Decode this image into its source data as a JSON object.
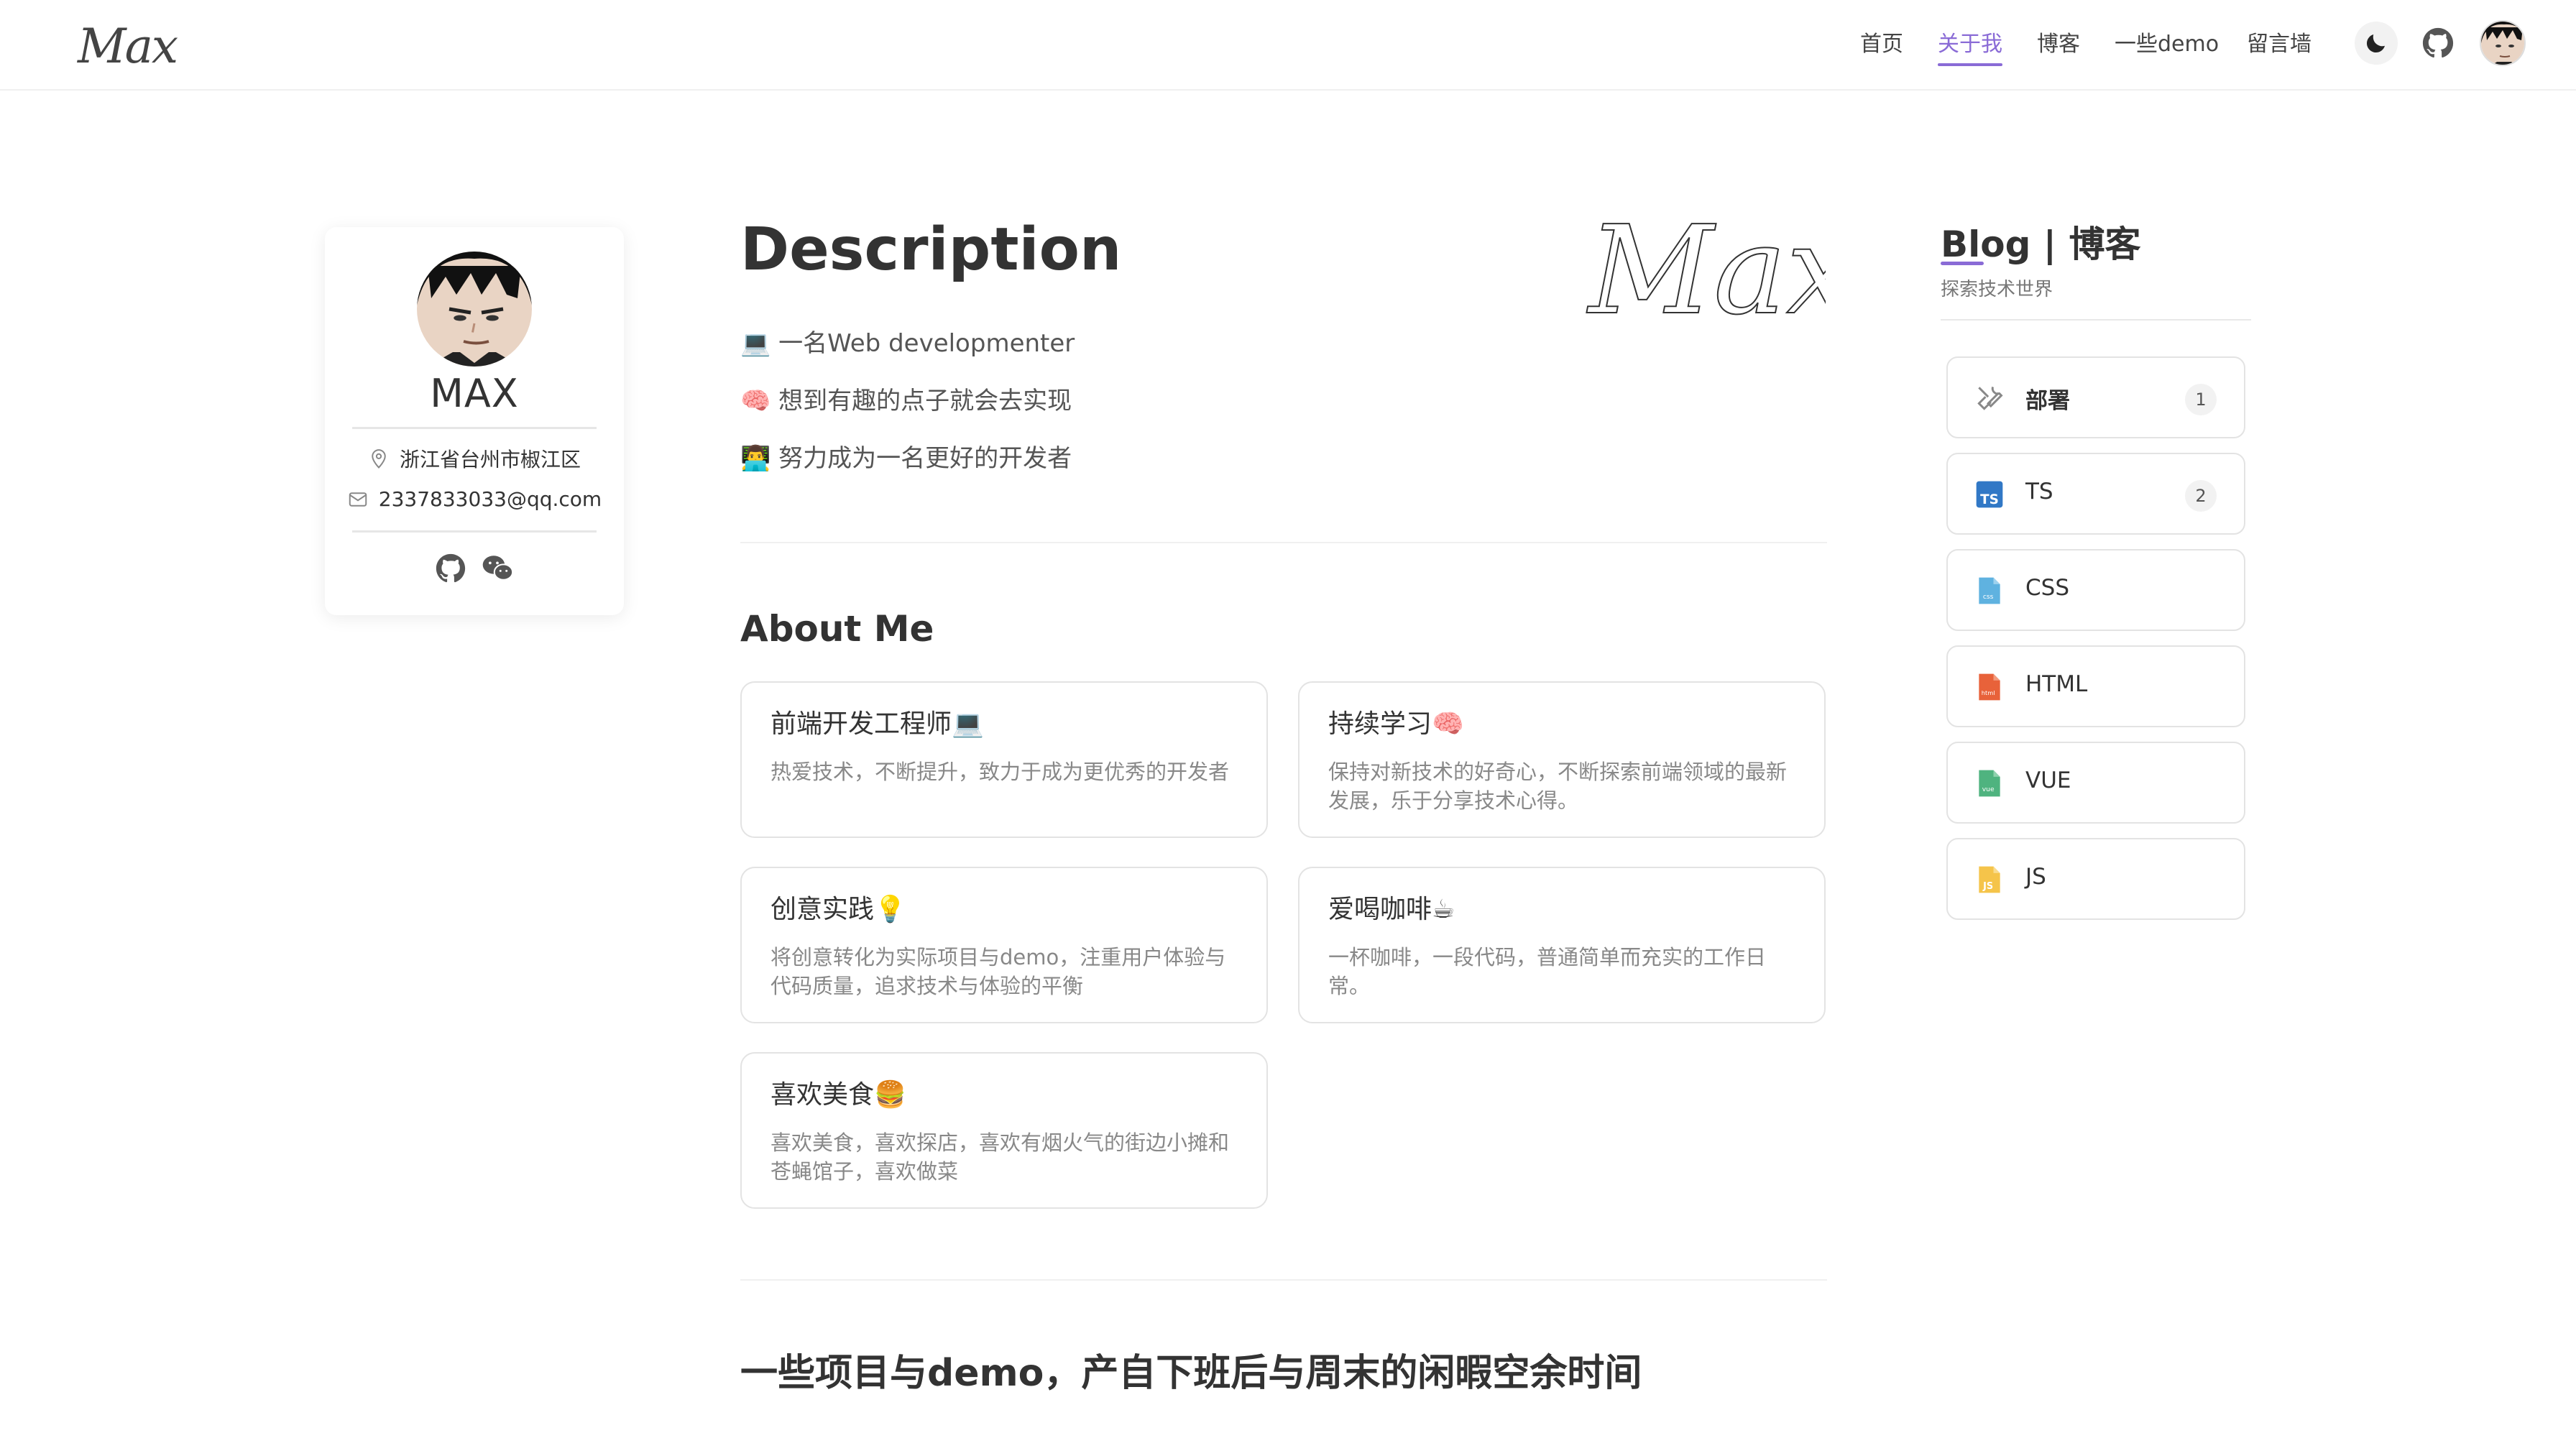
{
  "header": {
    "logo": "Max",
    "nav": [
      {
        "label": "首页",
        "active": false
      },
      {
        "label": "关于我",
        "active": true
      },
      {
        "label": "博客",
        "active": false
      },
      {
        "label": "一些demo",
        "active": false
      },
      {
        "label": "留言墙",
        "active": false
      }
    ],
    "icons": [
      "moon-icon",
      "github-icon",
      "avatar"
    ],
    "accent": "#8a6bd6"
  },
  "profile": {
    "name": "MAX",
    "location": "浙江省台州市椒江区",
    "email": "2337833033@qq.com",
    "social_icons": [
      "github-icon",
      "wechat-icon"
    ]
  },
  "description": {
    "heading": "Description",
    "signature": "Max",
    "lines": [
      "💻 一名Web developmenter",
      "🧠 想到有趣的点子就会去实现",
      "👨‍💻 努力成为一名更好的开发者"
    ]
  },
  "about": {
    "heading": "About Me",
    "cards": [
      {
        "title": "前端开发工程师💻",
        "text": "热爱技术，不断提升，致力于成为更优秀的开发者"
      },
      {
        "title": "持续学习🧠",
        "text": "保持对新技术的好奇心，不断探索前端领域的最新发展，乐于分享技术心得。"
      },
      {
        "title": "创意实践💡",
        "text": "将创意转化为实际项目与demo，注重用户体验与代码质量，追求技术与体验的平衡"
      },
      {
        "title": "爱喝咖啡☕",
        "text": "一杯咖啡，一段代码，普通简单而充实的工作日常。"
      },
      {
        "title": "喜欢美食🍔",
        "text": "喜欢美食，喜欢探店，喜欢有烟火气的街边小摊和苍蝇馆子，喜欢做菜"
      }
    ]
  },
  "projects": {
    "heading": "一些项目与demo，产自下班后与周末的闲暇空余时间"
  },
  "sidebar": {
    "title": "Blog | 博客",
    "subtitle": "探索技术世界",
    "categories": [
      {
        "label": "部署",
        "count": "1",
        "icon": "tools-icon"
      },
      {
        "label": "TS",
        "count": "2",
        "icon": "ts-file-icon"
      },
      {
        "label": "CSS",
        "count": "",
        "icon": "css-file-icon"
      },
      {
        "label": "HTML",
        "count": "",
        "icon": "html-file-icon"
      },
      {
        "label": "VUE",
        "count": "",
        "icon": "vue-file-icon"
      },
      {
        "label": "JS",
        "count": "",
        "icon": "js-file-icon"
      }
    ]
  }
}
